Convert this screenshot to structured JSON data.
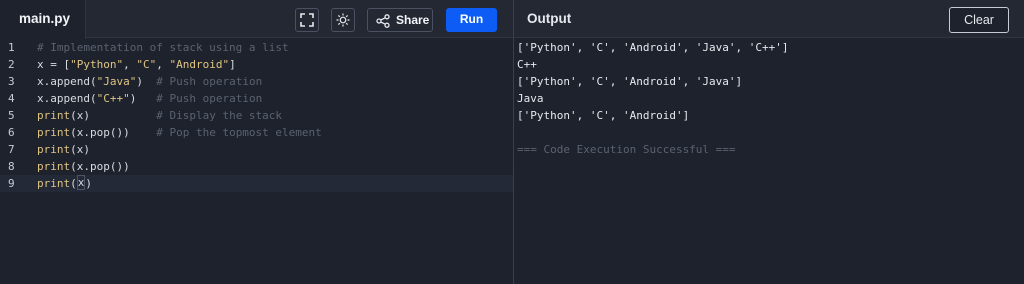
{
  "editor": {
    "file_tab": "main.py",
    "lines": [
      {
        "n": "1",
        "parts": [
          {
            "t": "# Implementation of stack using a list",
            "c": "cmt"
          }
        ]
      },
      {
        "n": "2",
        "parts": [
          {
            "t": "x = [",
            "c": ""
          },
          {
            "t": "\"Python\"",
            "c": "str"
          },
          {
            "t": ", ",
            "c": ""
          },
          {
            "t": "\"C\"",
            "c": "str"
          },
          {
            "t": ", ",
            "c": ""
          },
          {
            "t": "\"Android\"",
            "c": "str"
          },
          {
            "t": "]",
            "c": ""
          }
        ]
      },
      {
        "n": "3",
        "parts": [
          {
            "t": "x.append(",
            "c": ""
          },
          {
            "t": "\"Java\"",
            "c": "str"
          },
          {
            "t": ")  ",
            "c": ""
          },
          {
            "t": "# Push operation",
            "c": "cmt"
          }
        ]
      },
      {
        "n": "4",
        "parts": [
          {
            "t": "x.append(",
            "c": ""
          },
          {
            "t": "\"C++\"",
            "c": "str"
          },
          {
            "t": ")   ",
            "c": ""
          },
          {
            "t": "# Push operation",
            "c": "cmt"
          }
        ]
      },
      {
        "n": "5",
        "parts": [
          {
            "t": "print",
            "c": "fn"
          },
          {
            "t": "(x)          ",
            "c": ""
          },
          {
            "t": "# Display the stack",
            "c": "cmt"
          }
        ]
      },
      {
        "n": "6",
        "parts": [
          {
            "t": "print",
            "c": "fn"
          },
          {
            "t": "(x.pop())    ",
            "c": ""
          },
          {
            "t": "# Pop the topmost element",
            "c": "cmt"
          }
        ]
      },
      {
        "n": "7",
        "parts": [
          {
            "t": "print",
            "c": "fn"
          },
          {
            "t": "(x)",
            "c": ""
          }
        ]
      },
      {
        "n": "8",
        "parts": [
          {
            "t": "print",
            "c": "fn"
          },
          {
            "t": "(x.pop())",
            "c": ""
          }
        ]
      },
      {
        "n": "9",
        "parts": [
          {
            "t": "print",
            "c": "fn"
          },
          {
            "t": "(",
            "c": ""
          },
          {
            "t": "x",
            "c": "cur"
          },
          {
            "t": ")",
            "c": ""
          }
        ]
      }
    ],
    "active_line": "9"
  },
  "toolbar": {
    "fullscreen_icon": "fullscreen-icon",
    "theme_icon": "sun-icon",
    "share_icon": "share-icon",
    "share_label": "Share",
    "run_label": "Run",
    "run_color": "#0c5cf5"
  },
  "output": {
    "title": "Output",
    "clear_label": "Clear",
    "lines": [
      "['Python', 'C', 'Android', 'Java', 'C++']",
      "C++",
      "['Python', 'C', 'Android', 'Java']",
      "Java",
      "['Python', 'C', 'Android']",
      "",
      "=== Code Execution Successful ==="
    ]
  }
}
